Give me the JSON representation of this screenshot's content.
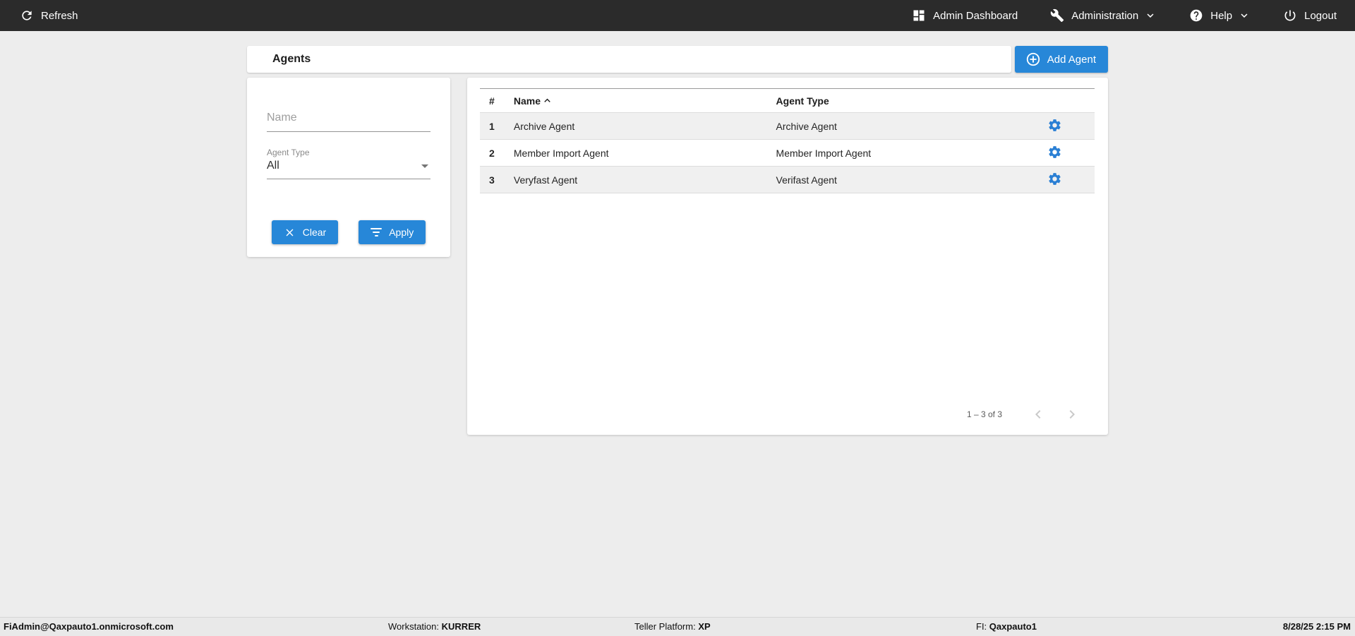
{
  "topbar": {
    "refresh": "Refresh",
    "admin_dashboard": "Admin Dashboard",
    "administration": "Administration",
    "help": "Help",
    "logout": "Logout"
  },
  "header": {
    "title": "Agents",
    "add_agent_label": "Add Agent"
  },
  "filters": {
    "name_placeholder": "Name",
    "agent_type_label": "Agent Type",
    "agent_type_value": "All",
    "clear_label": "Clear",
    "apply_label": "Apply"
  },
  "table": {
    "columns": [
      "#",
      "Name",
      "Agent Type"
    ],
    "sorted_column": "Name",
    "sort_direction": "asc",
    "rows": [
      {
        "num": "1",
        "name": "Archive Agent",
        "type": "Archive Agent"
      },
      {
        "num": "2",
        "name": "Member Import Agent",
        "type": "Member Import Agent"
      },
      {
        "num": "3",
        "name": "Veryfast Agent",
        "type": "Verifast Agent"
      }
    ],
    "pagination": {
      "range_label": "1 – 3 of 3"
    }
  },
  "footer": {
    "user": "FiAdmin@Qaxpauto1.onmicrosoft.com",
    "workstation_label": "Workstation:",
    "workstation_value": "KURRER",
    "teller_platform_label": "Teller Platform:",
    "teller_platform_value": "XP",
    "fi_label": "FI:",
    "fi_value": "Qaxpauto1",
    "datetime": "8/28/25 2:15 PM"
  },
  "colors": {
    "topbar_bg": "#2b2b2b",
    "accent_blue": "#2787d8",
    "gear_blue": "#2a7fd4",
    "row_stripe": "#f0f0f0",
    "page_bg": "#ededed"
  },
  "icons": {
    "refresh": "circular-arrow",
    "admin_dashboard": "dashboard-grid",
    "administration": "wrench",
    "help": "question-circle",
    "logout": "power",
    "add_agent": "plus-circle-outline",
    "clear": "x-mark",
    "apply": "filter-lines",
    "row_action": "gear",
    "sort": "chevron-up",
    "page_prev": "chevron-left",
    "page_next": "chevron-right",
    "agent_type_select": "triangle-down"
  }
}
